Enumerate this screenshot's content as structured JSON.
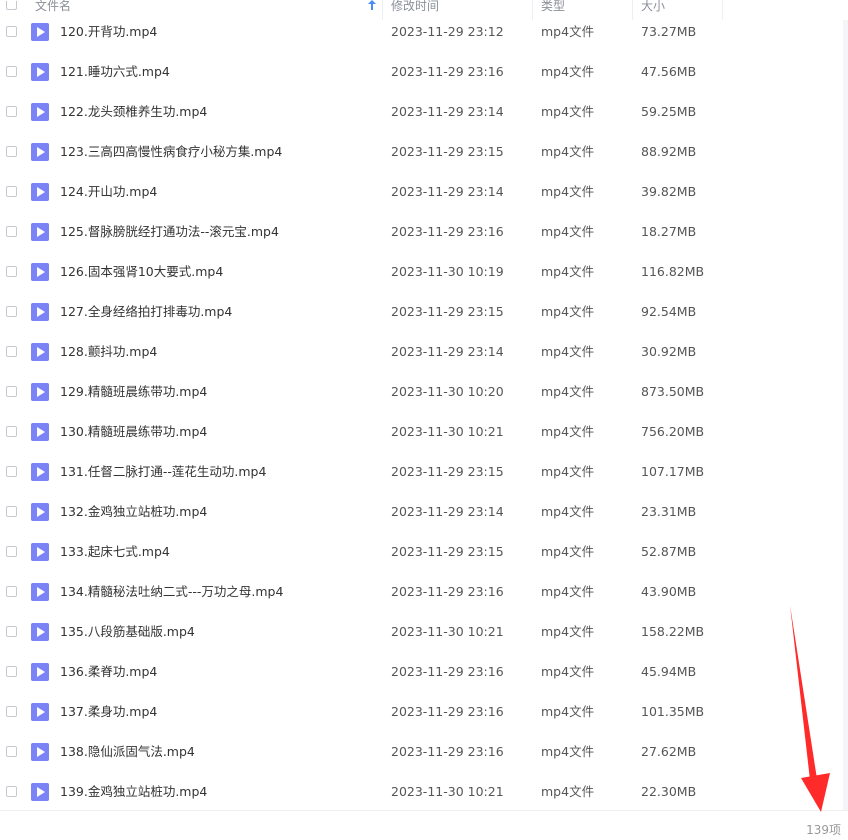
{
  "header": {
    "name_label": "文件名",
    "date_label": "修改时间",
    "type_label": "类型",
    "size_label": "大小"
  },
  "files": [
    {
      "name": "120.开背功.mp4",
      "date": "2023-11-29 23:12",
      "type": "mp4文件",
      "size": "73.27MB"
    },
    {
      "name": "121.睡功六式.mp4",
      "date": "2023-11-29 23:16",
      "type": "mp4文件",
      "size": "47.56MB"
    },
    {
      "name": "122.龙头颈椎养生功.mp4",
      "date": "2023-11-29 23:14",
      "type": "mp4文件",
      "size": "59.25MB"
    },
    {
      "name": "123.三高四高慢性病食疗小秘方集.mp4",
      "date": "2023-11-29 23:15",
      "type": "mp4文件",
      "size": "88.92MB"
    },
    {
      "name": "124.开山功.mp4",
      "date": "2023-11-29 23:14",
      "type": "mp4文件",
      "size": "39.82MB"
    },
    {
      "name": "125.督脉膀胱经打通功法--滚元宝.mp4",
      "date": "2023-11-29 23:16",
      "type": "mp4文件",
      "size": "18.27MB"
    },
    {
      "name": "126.固本强肾10大要式.mp4",
      "date": "2023-11-30 10:19",
      "type": "mp4文件",
      "size": "116.82MB"
    },
    {
      "name": "127.全身经络拍打排毒功.mp4",
      "date": "2023-11-29 23:15",
      "type": "mp4文件",
      "size": "92.54MB"
    },
    {
      "name": "128.颤抖功.mp4",
      "date": "2023-11-29 23:14",
      "type": "mp4文件",
      "size": "30.92MB"
    },
    {
      "name": "129.精髓班晨练带功.mp4",
      "date": "2023-11-30 10:20",
      "type": "mp4文件",
      "size": "873.50MB"
    },
    {
      "name": "130.精髓班晨练带功.mp4",
      "date": "2023-11-30 10:21",
      "type": "mp4文件",
      "size": "756.20MB"
    },
    {
      "name": "131.任督二脉打通--莲花生动功.mp4",
      "date": "2023-11-29 23:15",
      "type": "mp4文件",
      "size": "107.17MB"
    },
    {
      "name": "132.金鸡独立站桩功.mp4",
      "date": "2023-11-29 23:14",
      "type": "mp4文件",
      "size": "23.31MB"
    },
    {
      "name": "133.起床七式.mp4",
      "date": "2023-11-29 23:15",
      "type": "mp4文件",
      "size": "52.87MB"
    },
    {
      "name": "134.精髓秘法吐纳二式---万功之母.mp4",
      "date": "2023-11-29 23:16",
      "type": "mp4文件",
      "size": "43.90MB"
    },
    {
      "name": "135.八段筋基础版.mp4",
      "date": "2023-11-30 10:21",
      "type": "mp4文件",
      "size": "158.22MB"
    },
    {
      "name": "136.柔脊功.mp4",
      "date": "2023-11-29 23:16",
      "type": "mp4文件",
      "size": "45.94MB"
    },
    {
      "name": "137.柔身功.mp4",
      "date": "2023-11-29 23:16",
      "type": "mp4文件",
      "size": "101.35MB"
    },
    {
      "name": "138.隐仙派固气法.mp4",
      "date": "2023-11-29 23:16",
      "type": "mp4文件",
      "size": "27.62MB"
    },
    {
      "name": "139.金鸡独立站桩功.mp4",
      "date": "2023-11-30 10:21",
      "type": "mp4文件",
      "size": "22.30MB"
    }
  ],
  "footer": {
    "item_count": "139项"
  },
  "colors": {
    "icon": "#7b83f7",
    "arrow": "#ff2a2a",
    "sort_arrow": "#4a8cf7"
  },
  "icons": {
    "file_icon": "video-file-icon",
    "sort_icon": "sort-up-arrow-icon"
  }
}
